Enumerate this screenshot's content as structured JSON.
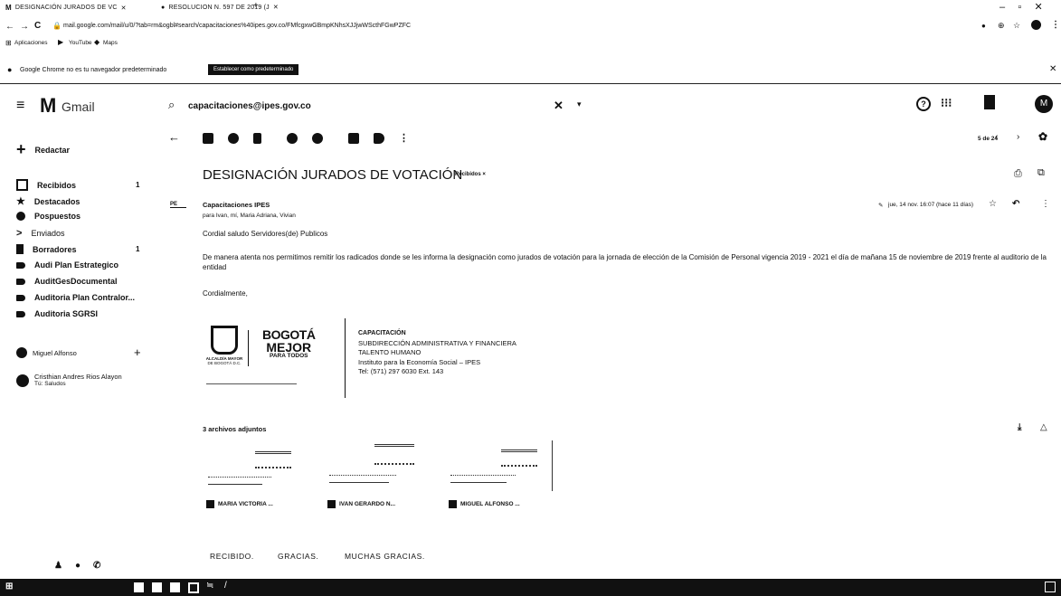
{
  "browser": {
    "tabs": [
      {
        "label": "DESIGNACIÓN JURADOS DE VC"
      },
      {
        "label": "RESOLUCION N. 597 DE 2019 (J"
      }
    ],
    "new_tab": "+",
    "url": "mail.google.com/mail/u/0/?tab=rm&ogbl#search/capacitaciones%40ipes.gov.co/FMfcgxwGBmpKNhsXJJjwWScthFGwPZFC",
    "bookmarks": [
      {
        "label": "Aplicaciones"
      },
      {
        "label": "YouTube"
      },
      {
        "label": "Maps"
      }
    ],
    "infobar_text": "Google Chrome no es tu navegador predeterminado",
    "infobar_button": "Establecer como predeterminado",
    "window_controls": [
      "–",
      "▫",
      "✕"
    ]
  },
  "gmail": {
    "logo_text": "Gmail",
    "search_value": "capacitaciones@ipes.gov.co",
    "search_clear": "✕",
    "avatar_letter": "M",
    "compose_label": "Redactar",
    "nav": [
      {
        "label": "Recibidos",
        "count": "1"
      },
      {
        "label": "Destacados",
        "count": ""
      },
      {
        "label": "Pospuestos",
        "count": ""
      },
      {
        "label": "Enviados",
        "count": ""
      },
      {
        "label": "Borradores",
        "count": "1"
      },
      {
        "label": "Audi Plan Estrategico",
        "count": ""
      },
      {
        "label": "AuditGesDocumental",
        "count": ""
      },
      {
        "label": "Auditoria Plan Contralor...",
        "count": ""
      },
      {
        "label": "Auditoria SGRSI",
        "count": ""
      }
    ],
    "hangouts_user": "Miguel Alfonso",
    "hangouts_contact": {
      "name": "Cristhian Andres Rios Alayon",
      "status": "Tú: Saludos"
    },
    "pager": "5 de 24",
    "subject": "DESIGNACIÓN JURADOS DE VOTACIÓN",
    "subject_label": "Recibidos ×",
    "sender": "Capacitaciones IPES",
    "sender_avatar": "PE",
    "recipients": "para Ivan, mí, Maria Adriana, Vivian",
    "date": "jue, 14 nov. 16:07 (hace 11 días)",
    "greeting": "Cordial saludo Servidores(de) Publicos",
    "body": "De manera atenta nos permitimos remitir los radicados donde se les informa la designación como jurados de votación para la jornada de elección de la Comisión de Personal vigencia 2019 - 2021 el día de mañana 15 de noviembre de 2019 frente al auditorio de la entidad",
    "closing": "Cordialmente,",
    "signature": {
      "logo_left_line1": "ALCALDÍA MAYOR",
      "logo_left_line2": "DE BOGOTÁ D.C.",
      "logo_right_line1": "BOGOTÁ",
      "logo_right_line2": "MEJOR",
      "logo_right_line3": "PARA TODOS",
      "line1": "CAPACITACIÓN",
      "line2": "SUBDIRECCIÓN ADMINISTRATIVA Y FINANCIERA",
      "line3": "TALENTO HUMANO",
      "line4": "Instituto para la Economía Social – IPES",
      "line5": "Tel: (571) 297 6030 Ext. 143"
    },
    "attachments_title": "3 archivos adjuntos",
    "attachments": [
      {
        "name": "MARIA VICTORIA ..."
      },
      {
        "name": "IVAN GERARDO N..."
      },
      {
        "name": "MIGUEL ALFONSO ..."
      }
    ],
    "smart_replies": [
      "RECIBIDO.",
      "GRACIAS.",
      "MUCHAS GRACIAS."
    ]
  }
}
